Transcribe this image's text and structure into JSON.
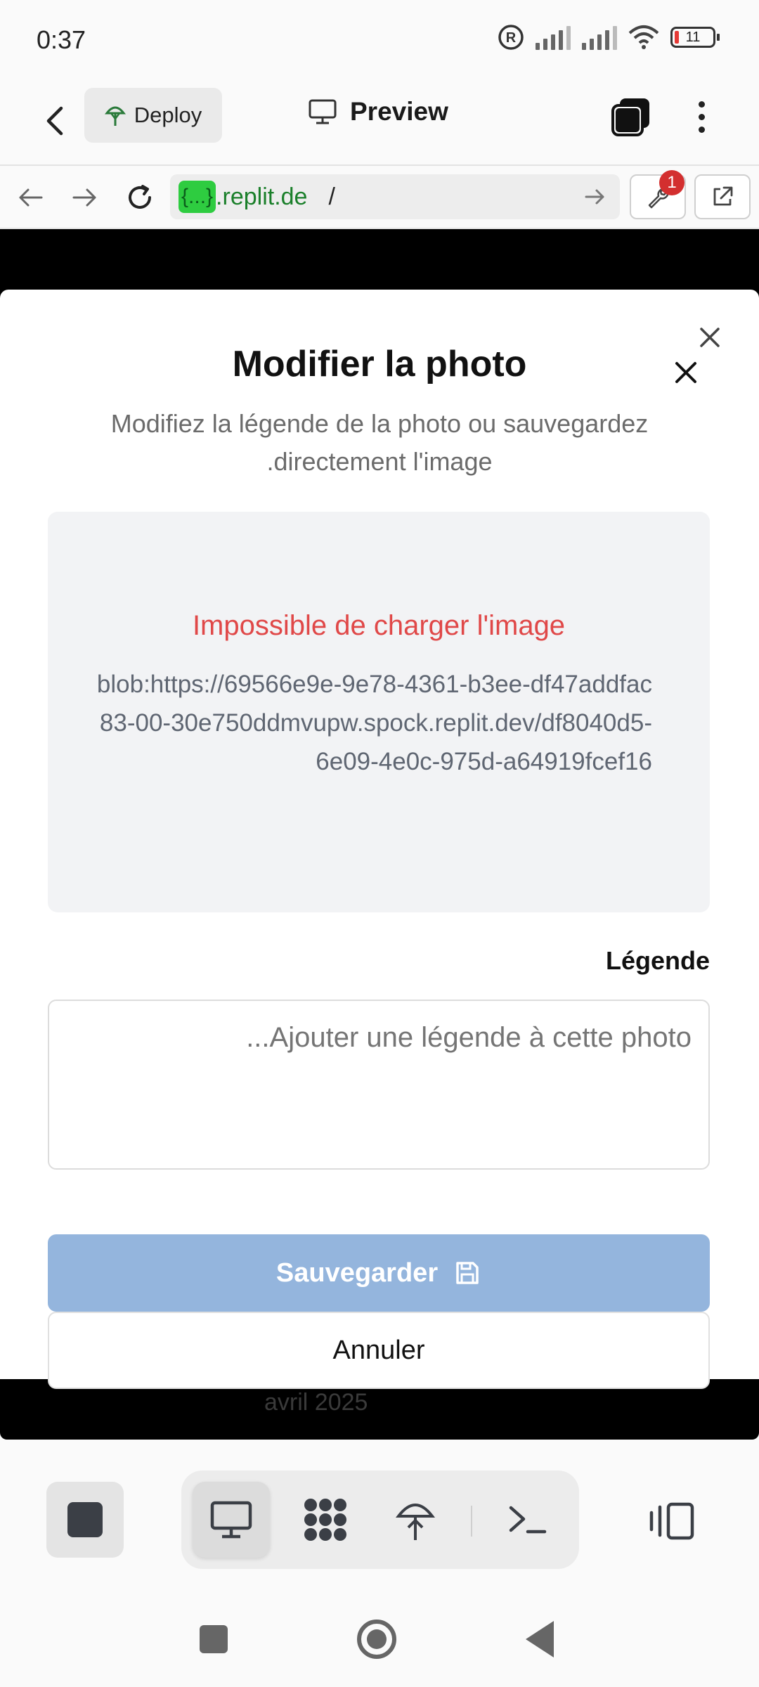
{
  "status_bar": {
    "time": "0:37",
    "battery": "11"
  },
  "app_bar": {
    "deploy_label": "Deploy",
    "preview_label": "Preview"
  },
  "url_bar": {
    "badge": "{...}",
    "domain": ".replit.de",
    "path": "/",
    "devtools_count": "1"
  },
  "modal": {
    "title": "Modifier la photo",
    "subtitle": "Modifiez la légende de la photo ou sauvegardez .directement l'image",
    "image_error": "Impossible de charger l'image",
    "image_url": "blob:https://69566e9e-9e78-4361-b3ee-df47addfac83-00-30e750ddmvupw.spock.replit.dev/df8040d5-6e09-4e0c-975d-a64919fcef16",
    "caption_label": "Légende",
    "caption_placeholder": "...Ajouter une légende à cette photo",
    "caption_value": "",
    "save_label": "Sauvegarder",
    "cancel_label": "Annuler"
  },
  "backdrop": {
    "month_label": "avril 2025"
  },
  "colors": {
    "accent_save": "#94b5dd",
    "error": "#e04848",
    "url_badge": "#2ecc40",
    "devtools_badge": "#d32f2f"
  }
}
